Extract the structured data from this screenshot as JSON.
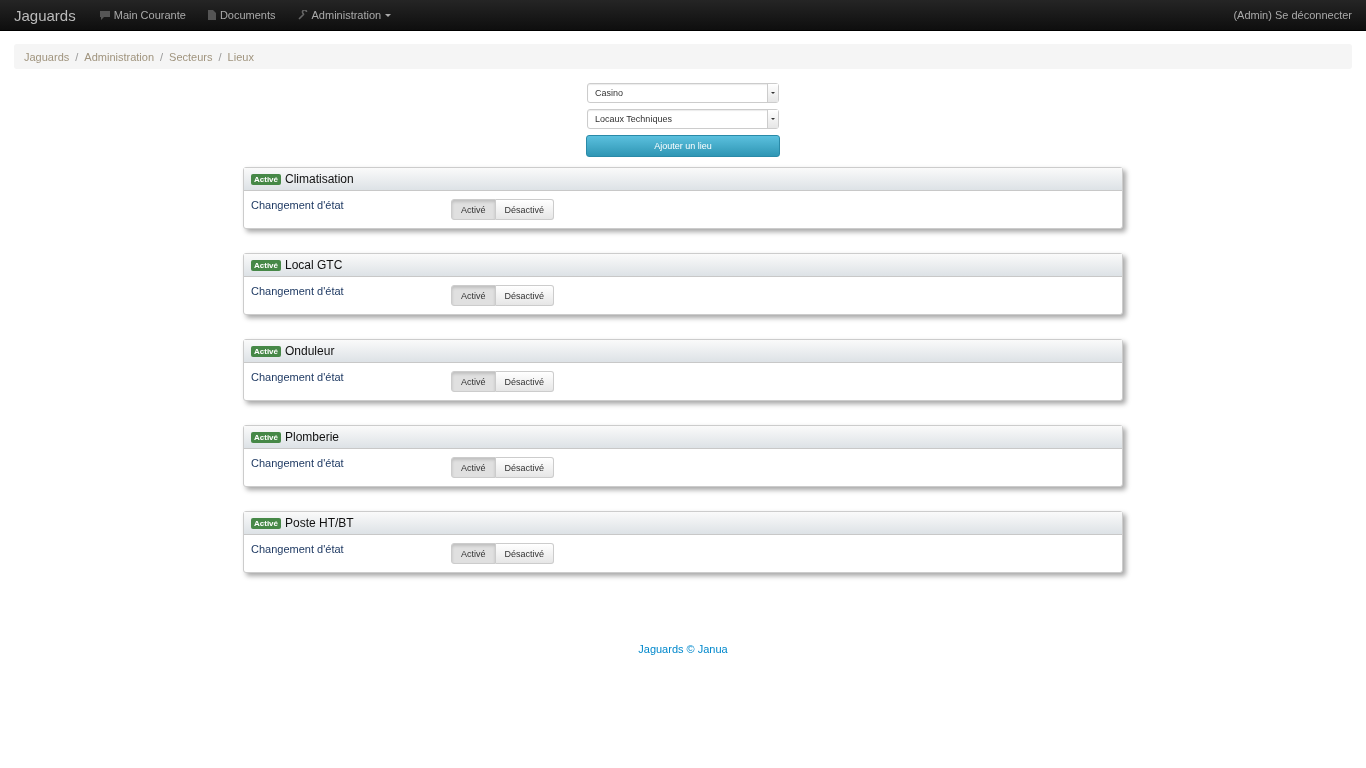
{
  "navbar": {
    "brand": "Jaguards",
    "items": [
      {
        "label": "Main Courante",
        "kind": "chat",
        "dropdown": false
      },
      {
        "label": "Documents",
        "kind": "document",
        "dropdown": false
      },
      {
        "label": "Administration",
        "kind": "wrench",
        "dropdown": true
      }
    ],
    "user_link": "(Admin) Se déconnecter"
  },
  "breadcrumb": [
    {
      "label": "Jaguards",
      "separator": "/"
    },
    {
      "label": "Administration",
      "separator": "/"
    },
    {
      "label": "Secteurs",
      "separator": "/"
    },
    {
      "label": "Lieux"
    }
  ],
  "filters": [
    {
      "value": "Casino"
    },
    {
      "value": "Locaux Techniques"
    }
  ],
  "add_button": "Ajouter un lieu",
  "places": [
    {
      "badge": "Activé",
      "name": "Climatisation",
      "label": "Changement d'état",
      "options": [
        {
          "label": "Activé",
          "selected": true
        },
        {
          "label": "Désactivé",
          "selected": false
        }
      ]
    },
    {
      "badge": "Activé",
      "name": "Local GTC",
      "label": "Changement d'état",
      "options": [
        {
          "label": "Activé",
          "selected": true
        },
        {
          "label": "Désactivé",
          "selected": false
        }
      ]
    },
    {
      "badge": "Activé",
      "name": "Onduleur",
      "label": "Changement d'état",
      "options": [
        {
          "label": "Activé",
          "selected": true
        },
        {
          "label": "Désactivé",
          "selected": false
        }
      ]
    },
    {
      "badge": "Activé",
      "name": "Plomberie",
      "label": "Changement d'état",
      "options": [
        {
          "label": "Activé",
          "selected": true
        },
        {
          "label": "Désactivé",
          "selected": false
        }
      ]
    },
    {
      "badge": "Activé",
      "name": "Poste HT/BT",
      "label": "Changement d'état",
      "options": [
        {
          "label": "Activé",
          "selected": true
        },
        {
          "label": "Désactivé",
          "selected": false
        }
      ]
    }
  ],
  "footer": "Jaguards © Janua"
}
